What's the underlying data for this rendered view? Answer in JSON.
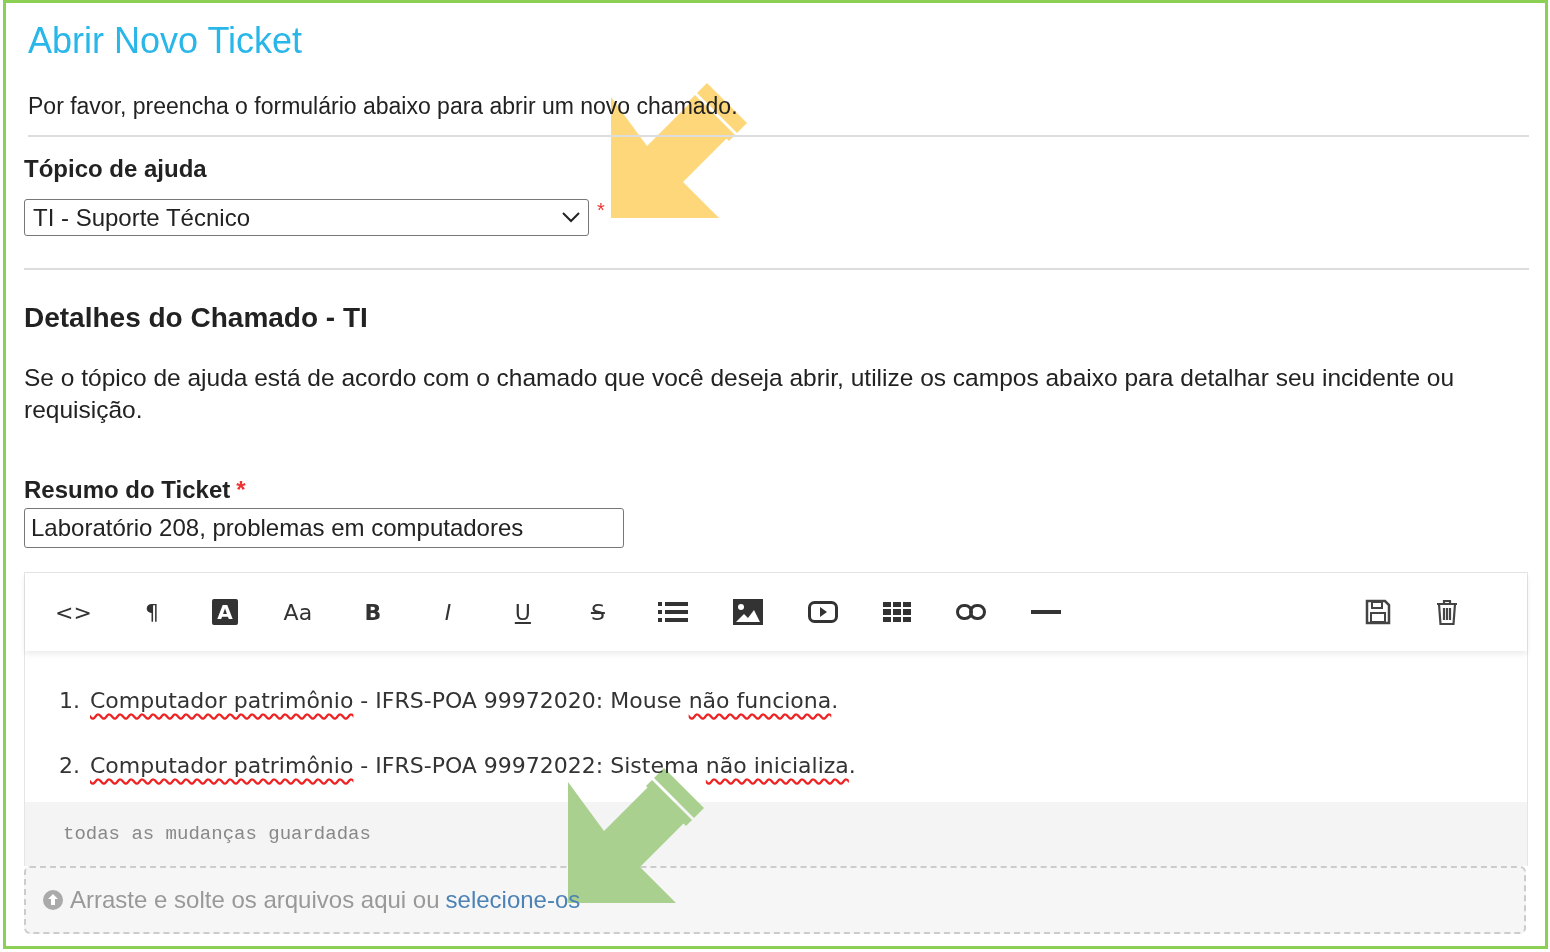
{
  "title": "Abrir Novo Ticket",
  "intro": "Por favor, preencha o formulário abaixo para abrir um novo chamado.",
  "help_topic": {
    "label": "Tópico de ajuda",
    "value": "TI - Suporte Técnico",
    "required_mark": "*"
  },
  "details": {
    "heading": "Detalhes do Chamado - TI",
    "description": "Se o tópico de ajuda está de acordo com o chamado que você deseja abrir, utilize os campos abaixo para detalhar seu incidente ou requisição."
  },
  "summary": {
    "label": "Resumo do Ticket",
    "required_mark": "*",
    "value": "Laboratório 208, problemas em computadores"
  },
  "editor": {
    "toolbar": [
      {
        "kind": "glyph",
        "label": "<>"
      },
      {
        "kind": "glyph",
        "label": "¶"
      },
      {
        "kind": "inverse",
        "label": "A"
      },
      {
        "kind": "glyph",
        "label": "Aa"
      },
      {
        "kind": "bold",
        "label": "B"
      },
      {
        "kind": "italic",
        "label": "I"
      },
      {
        "kind": "underline",
        "label": "U"
      },
      {
        "kind": "strike",
        "label": "S"
      },
      {
        "kind": "list"
      },
      {
        "kind": "image"
      },
      {
        "kind": "video"
      },
      {
        "kind": "table"
      },
      {
        "kind": "link"
      },
      {
        "kind": "rule"
      }
    ],
    "toolbar_right": [
      {
        "kind": "save"
      },
      {
        "kind": "trash"
      }
    ],
    "items": [
      {
        "number": "1.",
        "segments": [
          {
            "text": "Computador patrimônio",
            "misspelled": true
          },
          {
            "text": " - IFRS-POA 99972020: Mouse ",
            "misspelled": false
          },
          {
            "text": "não funciona",
            "misspelled": true
          }
        ],
        "end": "."
      },
      {
        "number": "2.",
        "segments": [
          {
            "text": "Computador patrimônio",
            "misspelled": true
          },
          {
            "text": " - IFRS-POA 99972022: Sistema ",
            "misspelled": false
          },
          {
            "text": "não inicializa",
            "misspelled": true
          }
        ],
        "end": "."
      }
    ],
    "status": "todas as mudanças guardadas"
  },
  "dropzone": {
    "text": "Arraste e solte os arquivos aqui ou",
    "link": "selecione-os"
  },
  "annotations": [
    {
      "color": "#fdd77a"
    },
    {
      "color": "#a9d08e"
    }
  ]
}
